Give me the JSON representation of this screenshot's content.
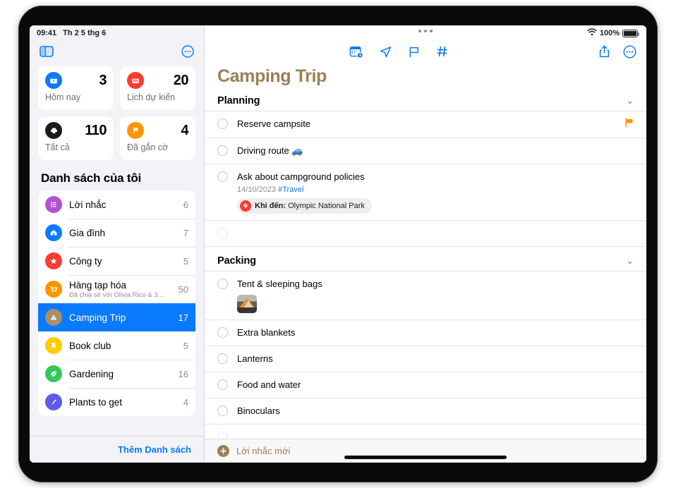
{
  "statusbar": {
    "time": "09:41",
    "date": "Th 2 5 thg 6",
    "battery_percent": "100%",
    "wifi_icon": "wifi-icon",
    "battery_icon": "battery-full-icon"
  },
  "sidebar": {
    "toggle_icon": "sidebar-toggle-icon",
    "more_icon": "more-options-icon",
    "smart_lists": [
      {
        "label": "Hôm nay",
        "count": "3",
        "icon": "calendar-today-icon",
        "color": "#0a7aff"
      },
      {
        "label": "Lịch dự kiến",
        "count": "20",
        "icon": "calendar-scheduled-icon",
        "color": "#ff3b30"
      },
      {
        "label": "Tất cả",
        "count": "110",
        "icon": "inbox-all-icon",
        "color": "#1c1c1e"
      },
      {
        "label": "Đã gắn cờ",
        "count": "4",
        "icon": "flag-icon",
        "color": "#ff9500"
      }
    ],
    "section_title": "Danh sách của tôi",
    "lists": [
      {
        "label": "Lời nhắc",
        "count": "6",
        "icon": "bulleted-list-icon",
        "color": "#b052d8",
        "subtitle": "",
        "selected": false
      },
      {
        "label": "Gia đình",
        "count": "7",
        "icon": "house-icon",
        "color": "#0a7aff",
        "subtitle": "",
        "selected": false
      },
      {
        "label": "Công ty",
        "count": "5",
        "icon": "star-icon",
        "color": "#ff3b30",
        "subtitle": "",
        "selected": false
      },
      {
        "label": "Hàng tạp hóa",
        "count": "50",
        "icon": "cart-icon",
        "color": "#ff9500",
        "subtitle": "Đã chia sẻ với Olivia Rico & 3…",
        "selected": false
      },
      {
        "label": "Camping Trip",
        "count": "17",
        "icon": "tent-triangle-icon",
        "color": "#a98f68",
        "subtitle": "",
        "selected": true
      },
      {
        "label": "Book club",
        "count": "5",
        "icon": "bookmark-icon",
        "color": "#ffcc00",
        "subtitle": "",
        "selected": false
      },
      {
        "label": "Gardening",
        "count": "16",
        "icon": "leaf-icon",
        "color": "#34c759",
        "subtitle": "",
        "selected": false
      },
      {
        "label": "Plants to get",
        "count": "4",
        "icon": "paintbrush-icon",
        "color": "#5e5ce6",
        "subtitle": "",
        "selected": false
      }
    ],
    "add_list_label": "Thêm Danh sách"
  },
  "main": {
    "multitask_handle": "multitask-handle",
    "toolbar_icons": [
      "calendar-badge-icon",
      "location-arrow-icon",
      "flag-outline-icon",
      "hashtag-icon"
    ],
    "share_icon": "share-icon",
    "more_icon": "more-options-icon",
    "title": "Camping Trip",
    "title_color": "#9c7f55",
    "sections": [
      {
        "name": "Planning",
        "chevron": "chevron-down-icon",
        "tasks": [
          {
            "title": "Reserve campsite",
            "meta": "",
            "tag": "",
            "flag": true,
            "chip": null,
            "thumb": false,
            "empty": false
          },
          {
            "title": "Driving route 🚙",
            "meta": "",
            "tag": "",
            "flag": false,
            "chip": null,
            "thumb": false,
            "empty": false
          },
          {
            "title": "Ask about campground policies",
            "meta": "14/10/2023",
            "tag": "#Travel",
            "flag": false,
            "chip": {
              "icon": "location-pin-icon",
              "prefix": "Khi đến:",
              "value": "Olympic National Park"
            },
            "thumb": false,
            "empty": false
          },
          {
            "title": "",
            "meta": "",
            "tag": "",
            "flag": false,
            "chip": null,
            "thumb": false,
            "empty": true
          }
        ]
      },
      {
        "name": "Packing",
        "chevron": "chevron-down-icon",
        "tasks": [
          {
            "title": "Tent & sleeping bags",
            "meta": "",
            "tag": "",
            "flag": false,
            "chip": null,
            "thumb": true,
            "empty": false
          },
          {
            "title": "Extra blankets",
            "meta": "",
            "tag": "",
            "flag": false,
            "chip": null,
            "thumb": false,
            "empty": false
          },
          {
            "title": "Lanterns",
            "meta": "",
            "tag": "",
            "flag": false,
            "chip": null,
            "thumb": false,
            "empty": false
          },
          {
            "title": "Food and water",
            "meta": "",
            "tag": "",
            "flag": false,
            "chip": null,
            "thumb": false,
            "empty": false
          },
          {
            "title": "Binoculars",
            "meta": "",
            "tag": "",
            "flag": false,
            "chip": null,
            "thumb": false,
            "empty": false
          },
          {
            "title": "",
            "meta": "",
            "tag": "",
            "flag": false,
            "chip": null,
            "thumb": false,
            "empty": true
          }
        ]
      }
    ],
    "add_reminder_label": "Lời nhắc mới",
    "add_reminder_icon": "plus-circle-icon"
  }
}
